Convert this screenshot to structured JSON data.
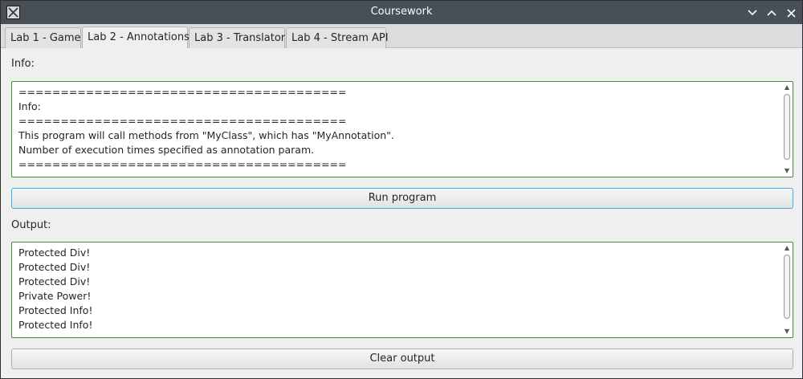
{
  "window": {
    "title": "Coursework",
    "app_icon": "x-app-icon",
    "controls": [
      "minimize-icon",
      "maximize-icon",
      "close-icon"
    ]
  },
  "tabs": [
    {
      "label": "Lab 1 - Game",
      "active": false
    },
    {
      "label": "Lab 2 - Annotations",
      "active": true
    },
    {
      "label": "Lab 3 - Translator",
      "active": false
    },
    {
      "label": "Lab 4 - Stream API",
      "active": false
    }
  ],
  "info": {
    "label": "Info:",
    "lines": [
      "=======================================",
      "Info:",
      "=======================================",
      "This program will call methods from \"MyClass\", which has \"MyAnnotation\".",
      "Number of execution times specified as annotation param.",
      "======================================="
    ]
  },
  "run_button": {
    "label": "Run program"
  },
  "output": {
    "label": "Output:",
    "lines": [
      "Protected Div!",
      "Protected Div!",
      "Protected Div!",
      "Private Power!",
      "Protected Info!",
      "Protected Info!"
    ]
  },
  "clear_button": {
    "label": "Clear output"
  },
  "colors": {
    "titlebar": "#475057",
    "focus_border": "#3a8f2f",
    "button_focus": "#3daee9"
  }
}
